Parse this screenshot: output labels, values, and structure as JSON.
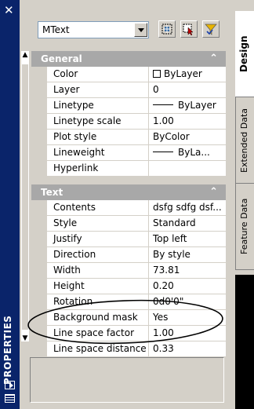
{
  "title_bar": {
    "title": "PROPERTIES",
    "close_icon": "close-icon"
  },
  "toolbar": {
    "selection_combo": "MText",
    "buttons": [
      "toggle-pickadd-icon",
      "select-objects-icon",
      "quick-select-icon"
    ]
  },
  "categories": [
    {
      "label": "General",
      "rows": [
        {
          "name": "Color",
          "value": "ByLayer",
          "kind": "color"
        },
        {
          "name": "Layer",
          "value": "0"
        },
        {
          "name": "Linetype",
          "value": "ByLayer",
          "kind": "linetype"
        },
        {
          "name": "Linetype scale",
          "value": "1.00"
        },
        {
          "name": "Plot style",
          "value": "ByColor"
        },
        {
          "name": "Lineweight",
          "value": "ByLa...",
          "kind": "linetype"
        },
        {
          "name": "Hyperlink",
          "value": ""
        }
      ]
    },
    {
      "label": "Text",
      "rows": [
        {
          "name": "Contents",
          "value": "dsfg sdfg dsf..."
        },
        {
          "name": "Style",
          "value": "Standard"
        },
        {
          "name": "Justify",
          "value": "Top left"
        },
        {
          "name": "Direction",
          "value": "By style"
        },
        {
          "name": "Width",
          "value": "73.81"
        },
        {
          "name": "Height",
          "value": "0.20"
        },
        {
          "name": "Rotation",
          "value": "0d0'0\""
        },
        {
          "name": "Background mask",
          "value": "Yes"
        },
        {
          "name": "Line space factor",
          "value": "1.00"
        },
        {
          "name": "Line space distance",
          "value": "0.33"
        }
      ]
    }
  ],
  "tabs": [
    {
      "label": "Design",
      "active": true
    },
    {
      "label": "Extended Data",
      "active": false
    },
    {
      "label": "Feature Data",
      "active": false
    }
  ],
  "colors": {
    "title_bar": "#0a246a",
    "panel": "#d4d0c8",
    "category_header": "#a8a8a8",
    "annotation": "#000000"
  }
}
